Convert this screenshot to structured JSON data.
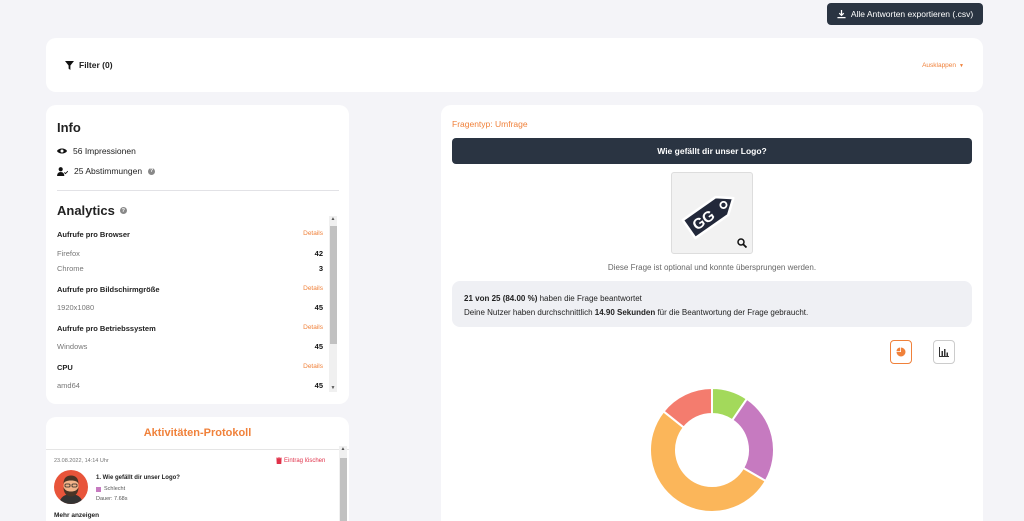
{
  "toolbar": {
    "export_label": "Alle Antworten exportieren (.csv)"
  },
  "filter": {
    "label": "Filter (0)",
    "expand_label": "Ausklappen"
  },
  "info": {
    "title": "Info",
    "impressions": "56 Impressionen",
    "votes": "25 Abstimmungen"
  },
  "analytics": {
    "title": "Analytics",
    "details_label": "Details",
    "groups": [
      {
        "title": "Aufrufe pro Browser",
        "rows": [
          {
            "label": "Firefox",
            "value": "42"
          },
          {
            "label": "Chrome",
            "value": "3"
          }
        ]
      },
      {
        "title": "Aufrufe pro Bildschirmgröße",
        "rows": [
          {
            "label": "1920x1080",
            "value": "45"
          }
        ]
      },
      {
        "title": "Aufrufe pro Betriebssystem",
        "rows": [
          {
            "label": "Windows",
            "value": "45"
          }
        ]
      },
      {
        "title": "CPU",
        "rows": [
          {
            "label": "amd64",
            "value": "45"
          }
        ]
      }
    ]
  },
  "log": {
    "title": "Aktivitäten-Protokoll",
    "date": "23.08.2022, 14:14 Uhr",
    "delete_label": "Eintrag löschen",
    "question": "1. Wie gefällt dir unser Logo?",
    "answer": "Schlecht",
    "duration": "Dauer: 7.68s",
    "more_label": "Mehr anzeigen"
  },
  "question": {
    "type_label": "Fragentyp: Umfrage",
    "title": "Wie gefällt dir unser Logo?",
    "logo_text": "GG",
    "optional_note": "Diese Frage ist optional und konnte übersprungen werden.",
    "answered_bold": "21 von 25 (84.00 %)",
    "answered_rest": " haben die Frage beantwortet",
    "time_prefix": "Deine Nutzer haben durchschnittlich ",
    "time_bold": "14.90 Sekunden",
    "time_suffix": " für die Beantwortung der Frage gebraucht."
  },
  "chart_data": {
    "type": "pie",
    "variant": "donut",
    "slices": [
      {
        "value": 2,
        "color": "#a3d95b"
      },
      {
        "value": 5,
        "color": "#c67ac0"
      },
      {
        "value": 11,
        "color": "#fbb65a"
      },
      {
        "value": 3,
        "color": "#f47c6e"
      }
    ]
  }
}
